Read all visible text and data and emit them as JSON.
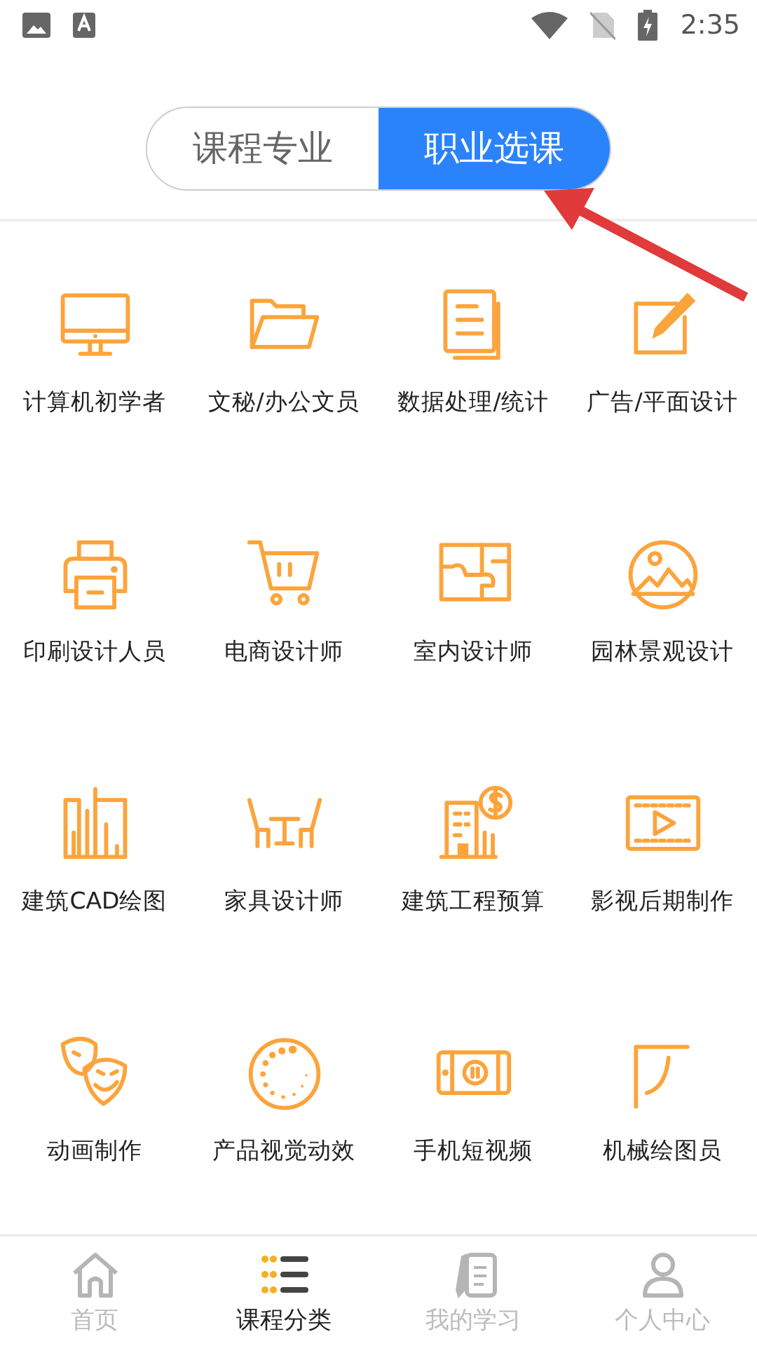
{
  "status_bar": {
    "time": "2:35"
  },
  "tabs": [
    {
      "label": "课程专业",
      "selected": false
    },
    {
      "label": "职业选课",
      "selected": true
    }
  ],
  "categories": [
    {
      "label": "计算机初学者"
    },
    {
      "label": "文秘/办公文员"
    },
    {
      "label": "数据处理/统计"
    },
    {
      "label": "广告/平面设计"
    },
    {
      "label": "印刷设计人员"
    },
    {
      "label": "电商设计师"
    },
    {
      "label": "室内设计师"
    },
    {
      "label": "园林景观设计"
    },
    {
      "label": "建筑CAD绘图"
    },
    {
      "label": "家具设计师"
    },
    {
      "label": "建筑工程预算"
    },
    {
      "label": "影视后期制作"
    },
    {
      "label": "动画制作"
    },
    {
      "label": "产品视觉动效"
    },
    {
      "label": "手机短视频"
    },
    {
      "label": "机械绘图员"
    }
  ],
  "bottom_nav": [
    {
      "label": "首页",
      "selected": false
    },
    {
      "label": "课程分类",
      "selected": true
    },
    {
      "label": "我的学习",
      "selected": false
    },
    {
      "label": "个人中心",
      "selected": false
    }
  ]
}
